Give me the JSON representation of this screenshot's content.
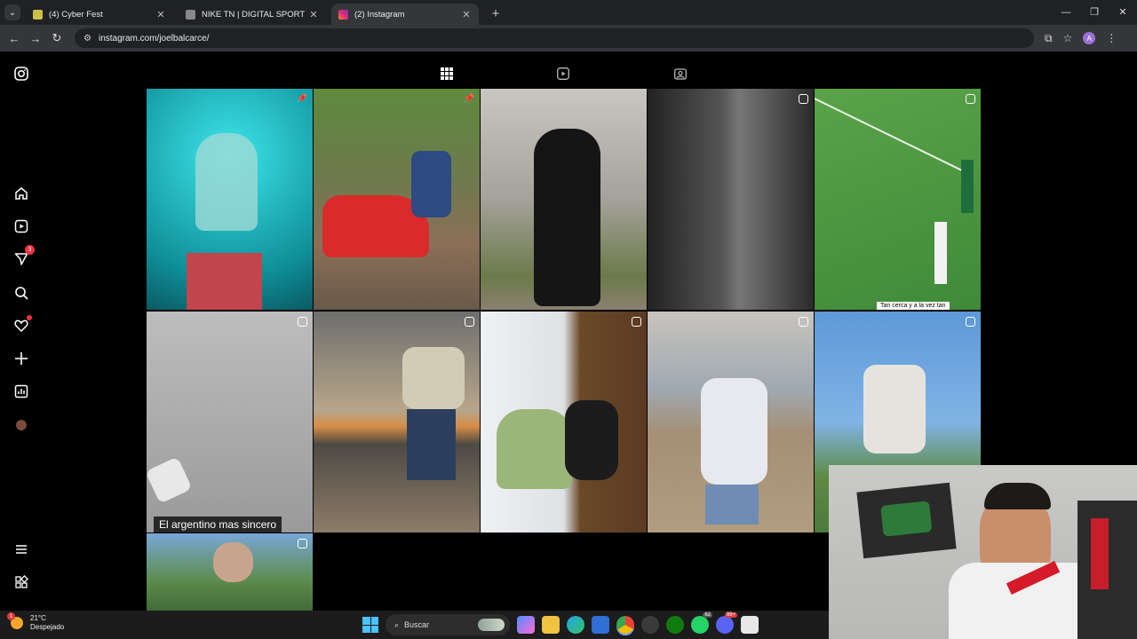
{
  "browser": {
    "tabs": [
      {
        "title": "(4) Cyber Fest",
        "favicon_color": "#c9c04a",
        "active": false
      },
      {
        "title": "NIKE TN | DIGITAL SPORT",
        "favicon_color": "#888888",
        "active": false
      },
      {
        "title": "(2) Instagram",
        "favicon_color": "#e1306c",
        "active": true
      }
    ],
    "new_tab": "+",
    "url": "instagram.com/joelbalcarce/",
    "profile_initial": "A"
  },
  "sidebar": {
    "notifications_badge": "3",
    "icons": [
      "instagram-logo-icon",
      "home-icon",
      "reels-icon",
      "messages-icon",
      "search-icon",
      "heart-icon",
      "create-icon",
      "dashboard-icon",
      "profile-avatar",
      "menu-icon",
      "apps-icon"
    ]
  },
  "profile_tabs": [
    "posts-grid-icon",
    "reels-tab-icon",
    "tagged-tab-icon"
  ],
  "posts": [
    {
      "type": "pinned",
      "bg": "#1fb9c0"
    },
    {
      "type": "pinned",
      "bg": "#7a7a55"
    },
    {
      "type": "photo",
      "bg": "#8c8b85"
    },
    {
      "type": "reel",
      "bg": "#3a3a3a"
    },
    {
      "type": "reel",
      "bg": "#4d8a3e",
      "caption": "Tan cerca y a la vez tan"
    },
    {
      "type": "reel",
      "bg": "#9a9a9a",
      "caption": "El argentino mas sincero"
    },
    {
      "type": "reel",
      "bg": "#6d6a63"
    },
    {
      "type": "reel",
      "bg": "#8f7e6a"
    },
    {
      "type": "reel",
      "bg": "#8b8278"
    },
    {
      "type": "reel",
      "bg": "#5c8bc4"
    },
    {
      "type": "reel",
      "bg": "#4b7a52"
    }
  ],
  "taskbar": {
    "temperature": "21°C",
    "condition": "Despejado",
    "weather_badge": "1",
    "search_placeholder": "Buscar",
    "whatsapp_badge": "62",
    "discord_badge": "99+"
  }
}
